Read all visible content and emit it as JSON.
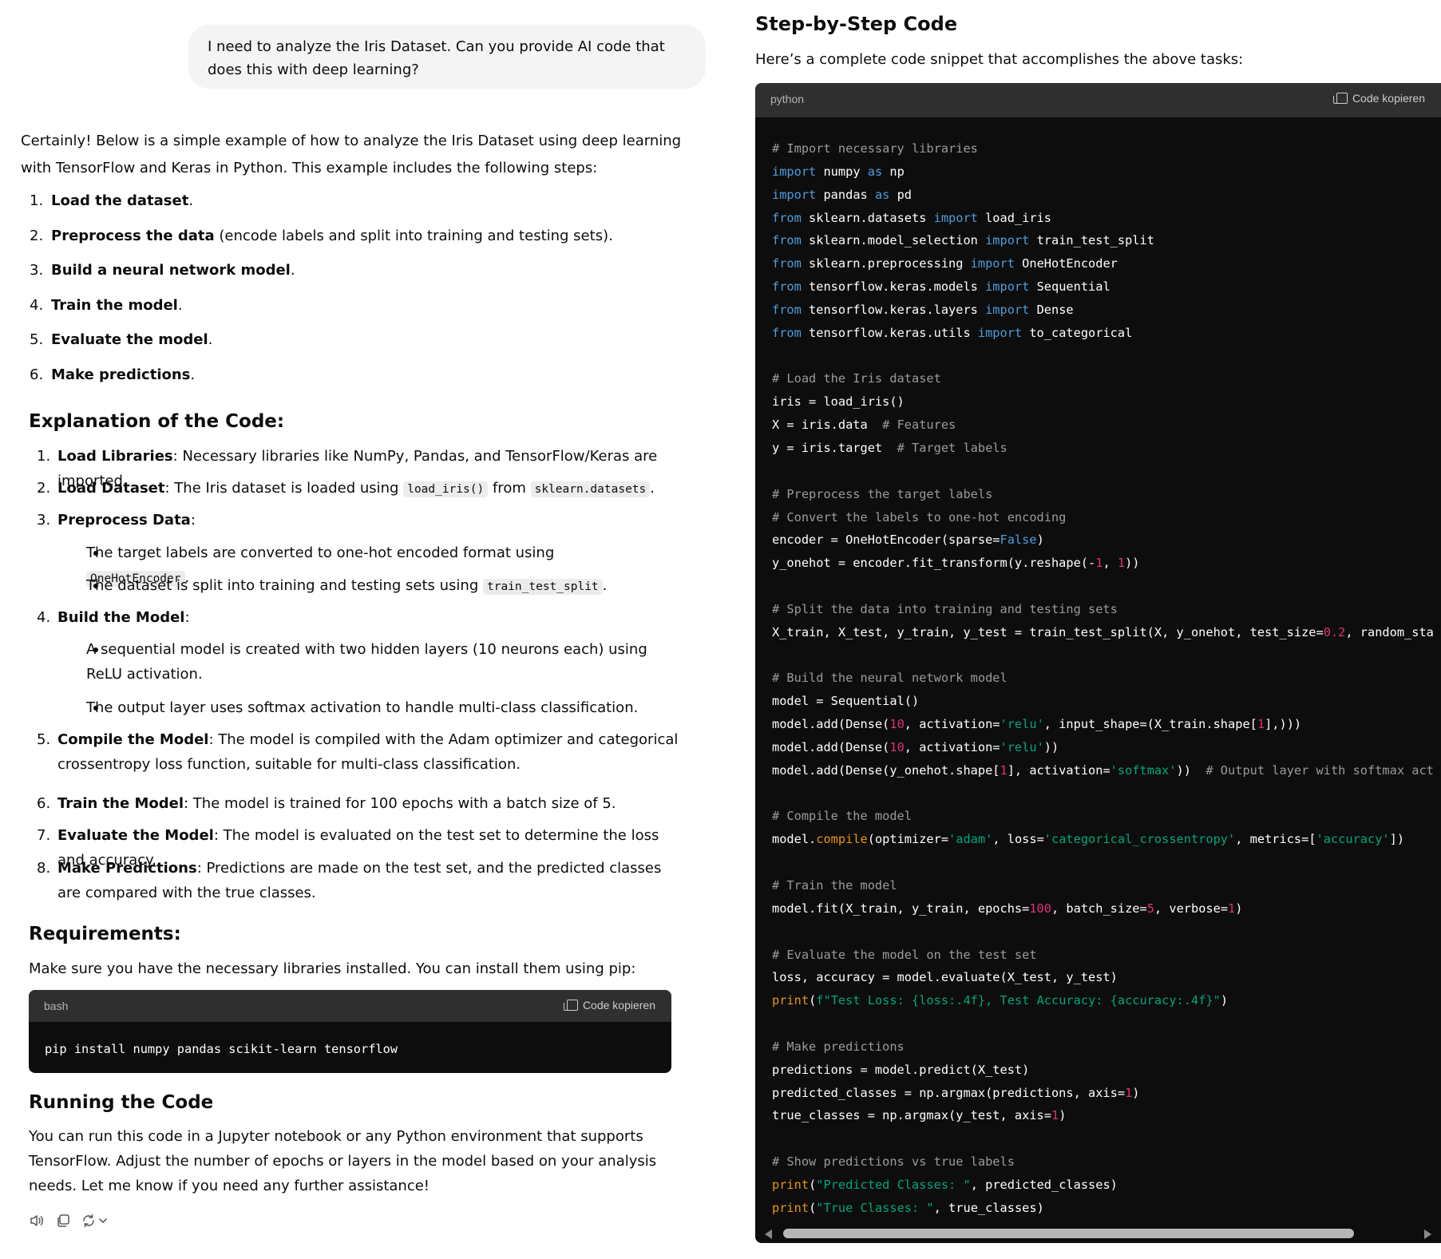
{
  "user_message": "I need to analyze the Iris Dataset. Can you provide AI code that does this with deep learning?",
  "intro": "Certainly! Below is a simple example of how to analyze the Iris Dataset using deep learning with TensorFlow and Keras in Python. This example includes the following steps:",
  "steps": [
    {
      "num": "1.",
      "bold": "Load the dataset",
      "rest": "."
    },
    {
      "num": "2.",
      "bold": "Preprocess the data",
      "rest": " (encode labels and split into training and testing sets)."
    },
    {
      "num": "3.",
      "bold": "Build a neural network model",
      "rest": "."
    },
    {
      "num": "4.",
      "bold": "Train the model",
      "rest": "."
    },
    {
      "num": "5.",
      "bold": "Evaluate the model",
      "rest": "."
    },
    {
      "num": "6.",
      "bold": "Make predictions",
      "rest": "."
    }
  ],
  "explanation_heading": "Explanation of the Code:",
  "explanation": {
    "i1": {
      "n": "1.",
      "b": "Load Libraries",
      "t": ": Necessary libraries like NumPy, Pandas, and TensorFlow/Keras are imported."
    },
    "i2": {
      "n": "2.",
      "b": "Load Dataset",
      "t1": ": The Iris dataset is loaded using ",
      "c1": "load_iris()",
      "t2": " from ",
      "c2": "sklearn.datasets",
      "t3": "."
    },
    "i3": {
      "n": "3.",
      "b": "Preprocess Data",
      "t": ":"
    },
    "i3a": {
      "t1": "The target labels are converted to one-hot encoded format using ",
      "c1": "OneHotEncoder",
      "t2": "."
    },
    "i3b": {
      "t1": "The dataset is split into training and testing sets using ",
      "c1": "train_test_split",
      "t2": "."
    },
    "i4": {
      "n": "4.",
      "b": "Build the Model",
      "t": ":"
    },
    "i4a": {
      "t": "A sequential model is created with two hidden layers (10 neurons each) using ReLU activation."
    },
    "i4b": {
      "t": "The output layer uses softmax activation to handle multi-class classification."
    },
    "i5": {
      "n": "5.",
      "b": "Compile the Model",
      "t": ": The model is compiled with the Adam optimizer and categorical crossentropy loss function, suitable for multi-class classification."
    },
    "i6": {
      "n": "6.",
      "b": "Train the Model",
      "t": ": The model is trained for 100 epochs with a batch size of 5."
    },
    "i7": {
      "n": "7.",
      "b": "Evaluate the Model",
      "t": ": The model is evaluated on the test set to determine the loss and accuracy."
    },
    "i8": {
      "n": "8.",
      "b": "Make Predictions",
      "t": ": Predictions are made on the test set, and the predicted classes are compared with the true classes."
    }
  },
  "requirements_heading": "Requirements:",
  "requirements_text": "Make sure you have the necessary libraries installed. You can install them using pip:",
  "bash_block": {
    "lang": "bash",
    "copy_label": "Code kopieren",
    "code": "pip install numpy pandas scikit-learn tensorflow"
  },
  "running_heading": "Running the Code",
  "running_text": "You can run this code in a Jupyter notebook or any Python environment that supports TensorFlow. Adjust the number of epochs or layers in the model based on your analysis needs. Let me know if you need any further assistance!",
  "actions": {
    "read_aloud": "speaker-icon",
    "copy": "copy-icon",
    "regenerate": "refresh-icon",
    "menu": "chevron-down-icon"
  },
  "right_heading": "Step-by-Step Code",
  "right_intro": "Here’s a complete code snippet that accomplishes the above tasks:",
  "python_block": {
    "lang": "python",
    "copy_label": "Code kopieren"
  },
  "colors": {
    "code_bg": "#0d0d0d",
    "code_header": "#2f2f2f",
    "keyword": "#4f9ddc",
    "string": "#00a67d",
    "number": "#df3079",
    "comment": "#9b9b9b",
    "builtin": "#e9950c"
  }
}
